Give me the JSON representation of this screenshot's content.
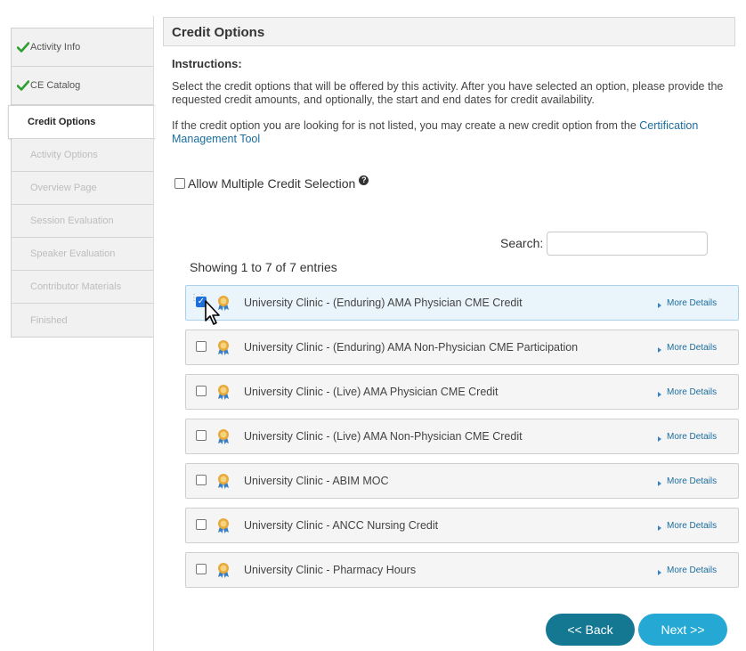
{
  "sidebar": {
    "items": [
      {
        "label": "Activity Info",
        "state": "done"
      },
      {
        "label": "CE Catalog",
        "state": "done"
      },
      {
        "label": "Credit Options",
        "state": "active"
      },
      {
        "label": "Activity Options",
        "state": "disabled"
      },
      {
        "label": "Overview Page",
        "state": "disabled"
      },
      {
        "label": "Session Evaluation",
        "state": "disabled"
      },
      {
        "label": "Speaker Evaluation",
        "state": "disabled"
      },
      {
        "label": "Contributor Materials",
        "state": "disabled"
      },
      {
        "label": "Finished",
        "state": "disabled"
      }
    ]
  },
  "header": {
    "title": "Credit Options"
  },
  "instructions": {
    "title": "Instructions:",
    "text": "Select the credit options that will be offered by this activity. After you have selected an option, please provide the requested credit amounts, and optionally, the start and end dates for credit availability.",
    "text2_prefix": "If the credit option you are looking for is not listed, you may create a new credit option from the ",
    "text2_link": "Certification Management Tool"
  },
  "allow_multiple": {
    "label": "Allow Multiple Credit Selection",
    "checked": false
  },
  "search": {
    "label": "Search:",
    "value": ""
  },
  "showing": "Showing 1 to 7 of 7 entries",
  "credits": [
    {
      "label": "University Clinic - (Enduring) AMA Physician CME Credit",
      "checked": true,
      "more": "More Details"
    },
    {
      "label": "University Clinic - (Enduring) AMA Non-Physician CME Participation",
      "checked": false,
      "more": "More Details"
    },
    {
      "label": "University Clinic - (Live) AMA Physician CME Credit",
      "checked": false,
      "more": "More Details"
    },
    {
      "label": "University Clinic - (Live) AMA Non-Physician CME Credit",
      "checked": false,
      "more": "More Details"
    },
    {
      "label": "University Clinic - ABIM MOC",
      "checked": false,
      "more": "More Details"
    },
    {
      "label": "University Clinic - ANCC Nursing Credit",
      "checked": false,
      "more": "More Details"
    },
    {
      "label": "University Clinic - Pharmacy Hours",
      "checked": false,
      "more": "More Details"
    }
  ],
  "buttons": {
    "back": "<< Back",
    "next": "Next >>"
  },
  "colors": {
    "link": "#1b6d9e",
    "back": "#147893",
    "next": "#25a8d3",
    "check": "#2e9e2e"
  }
}
